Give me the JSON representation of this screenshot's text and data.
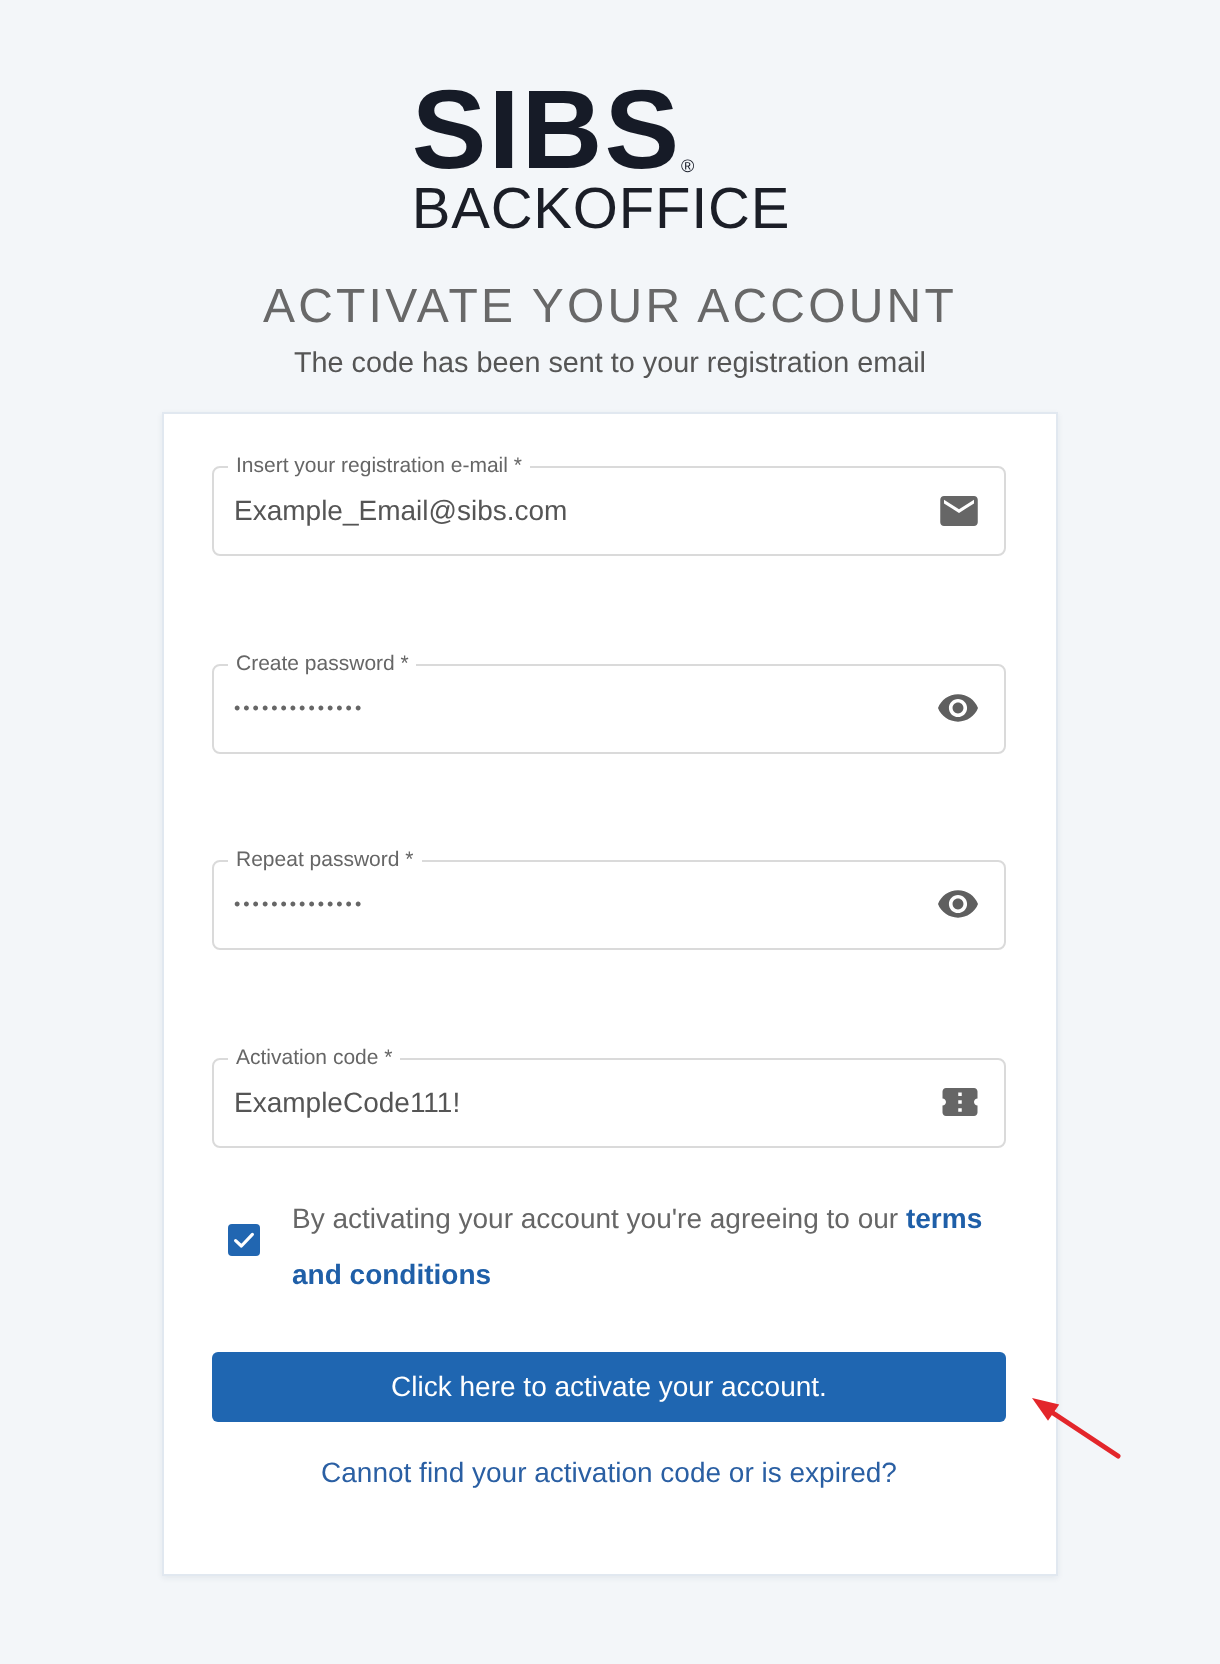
{
  "logo": {
    "wordmark": "SIBS",
    "registered_mark": "®",
    "product": "BACKOFFICE"
  },
  "heading": {
    "title": "ACTIVATE YOUR ACCOUNT",
    "subtitle": "The code has been sent to your registration email"
  },
  "form": {
    "fields": [
      {
        "kind": "email",
        "label": "Insert your registration e-mail *",
        "value": "Example_Email@sibs.com"
      },
      {
        "kind": "password",
        "label": "Create password *",
        "value": "••••••••••••••"
      },
      {
        "kind": "password",
        "label": "Repeat password *",
        "value": "••••••••••••••"
      },
      {
        "kind": "code",
        "label": "Activation code *",
        "value": "ExampleCode111!"
      }
    ],
    "agreement": {
      "checked": true,
      "text": "By activating your account you're agreeing to our",
      "link_lines": [
        "terms",
        "and conditions"
      ]
    },
    "submit_button": "Click here to activate your account.",
    "help_link": "Cannot find your activation code or is expired?"
  }
}
